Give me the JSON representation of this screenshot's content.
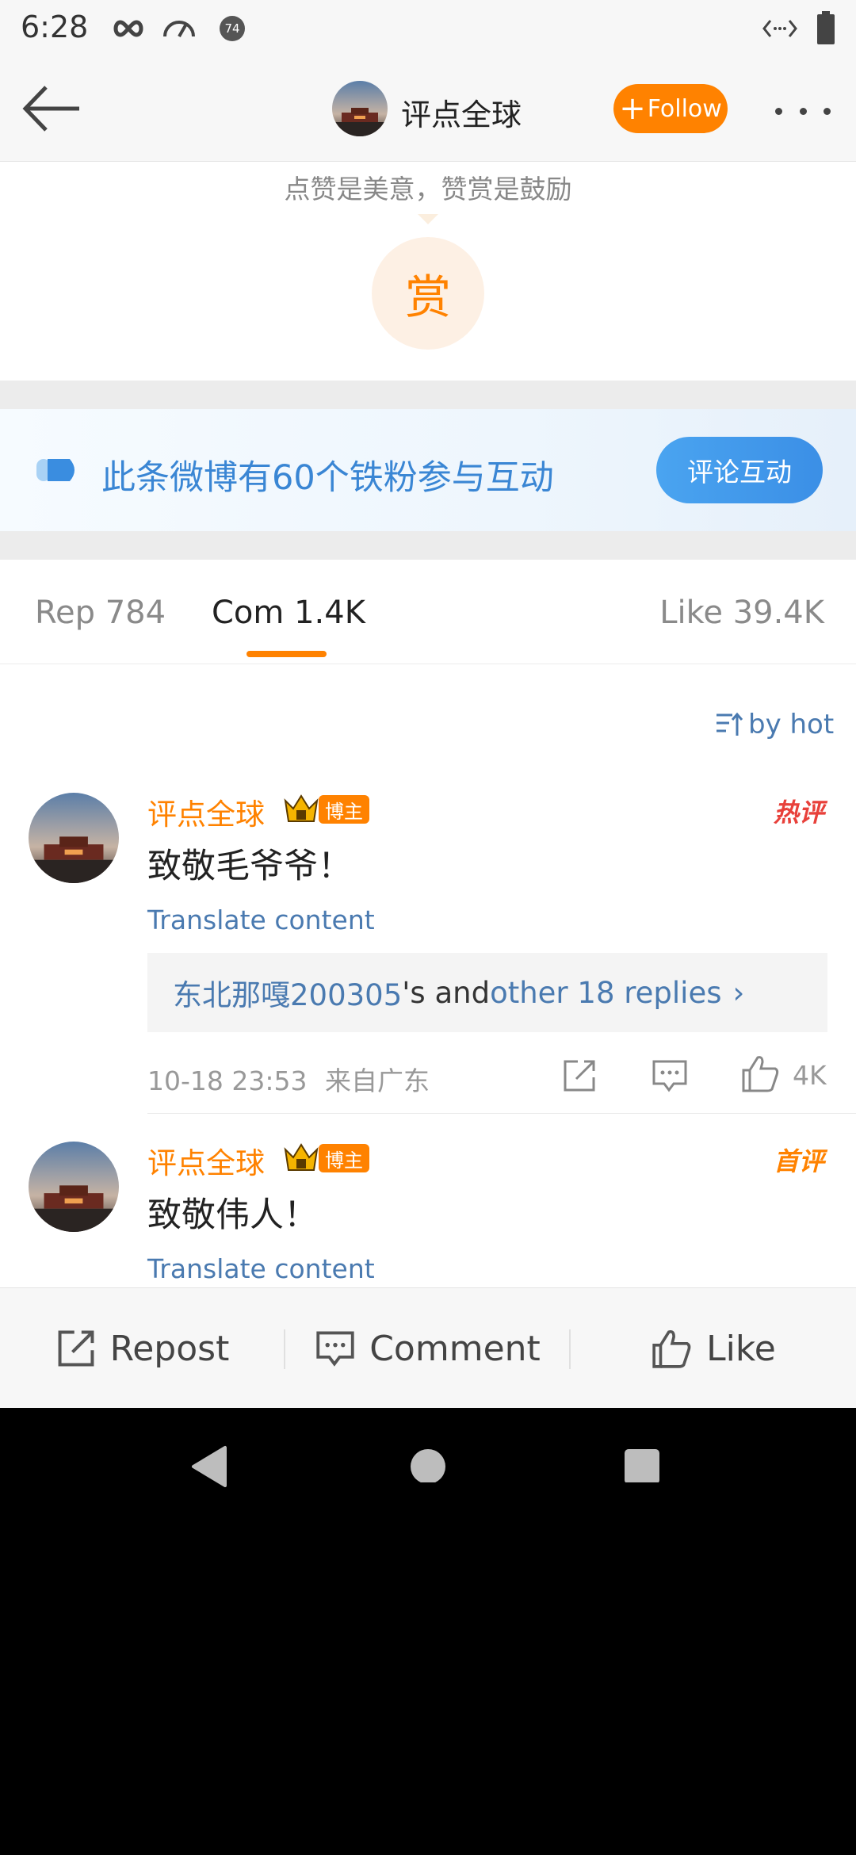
{
  "status_bar": {
    "time": "6:28",
    "icons": [
      "infinity-icon",
      "speedometer-icon",
      "badge-74-icon",
      "code-icon",
      "battery-icon"
    ],
    "badge_number": "74"
  },
  "header": {
    "title": "评点全球",
    "follow_label": "Follow",
    "follow_plus": "+"
  },
  "reward": {
    "tip": "点赞是美意，赞赏是鼓励",
    "button_label": "赏"
  },
  "fans_banner": {
    "text": "此条微博有60个铁粉参与互动",
    "button_label": "评论互动"
  },
  "tabs": [
    {
      "label": "Rep 784"
    },
    {
      "label": "Com 1.4K"
    },
    {
      "label": "Like 39.4K"
    }
  ],
  "sort_label": "by hot",
  "comments": [
    {
      "author": "评点全球",
      "badge": "博主",
      "tag": "热评",
      "text": "致敬毛爷爷！",
      "translate": "Translate content",
      "replies": {
        "user": "东北那嘎200305",
        "mid": "'s and ",
        "more": "other 18 replies",
        "chevron": "›"
      },
      "time": "10-18 23:53",
      "location": "来自广东",
      "likes": "4K"
    },
    {
      "author": "评点全球",
      "badge": "博主",
      "tag": "首评",
      "text": "致敬伟人！",
      "translate": "Translate content"
    }
  ],
  "bottom_bar": {
    "repost": "Repost",
    "comment": "Comment",
    "like": "Like"
  },
  "colors": {
    "accent": "#ff8200",
    "link": "#4a7ab0",
    "fans_blue": "#3a86d4",
    "hot_red": "#e8403a"
  }
}
